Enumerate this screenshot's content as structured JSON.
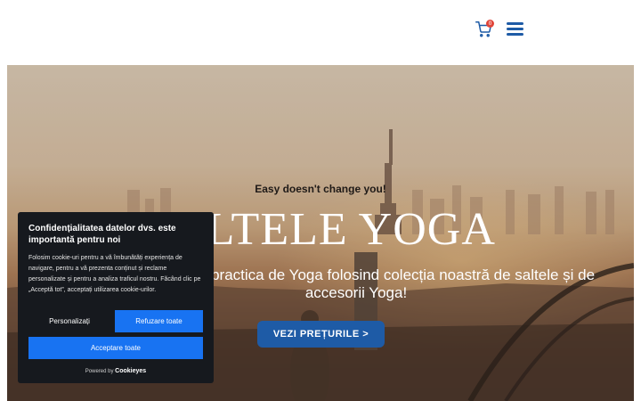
{
  "header": {
    "cart_count": "0",
    "cart_icon": "shopping-cart-icon",
    "menu_icon": "hamburger-menu-icon"
  },
  "hero": {
    "tagline": "Easy doesn't change you!",
    "title": "SALTELE YOGA",
    "subtitle": "Transformă-ți practica de Yoga folosind colecția noastră de saltele și de accesorii Yoga!",
    "cta_label": "VEZI PREȚURILE >"
  },
  "cookie_banner": {
    "title": "Confidențialitatea datelor dvs. este importantă pentru noi",
    "text": "Folosim cookie-uri pentru a vă îmbunătăți experiența de navigare, pentru a vă prezenta conținut și reclame personalizate și pentru a analiza traficul nostru. Făcând clic pe „Acceptă tot”, acceptați utilizarea cookie-urilor.",
    "customize_label": "Personalizați",
    "reject_label": "Refuzare toate",
    "accept_label": "Acceptare toate",
    "powered_prefix": "Powered by",
    "powered_brand": "Cookieyes"
  },
  "colors": {
    "brand_blue": "#1e5ba6",
    "cookie_button_blue": "#1873f2",
    "cookie_bg": "#16191e",
    "badge_red": "#e0453a"
  }
}
